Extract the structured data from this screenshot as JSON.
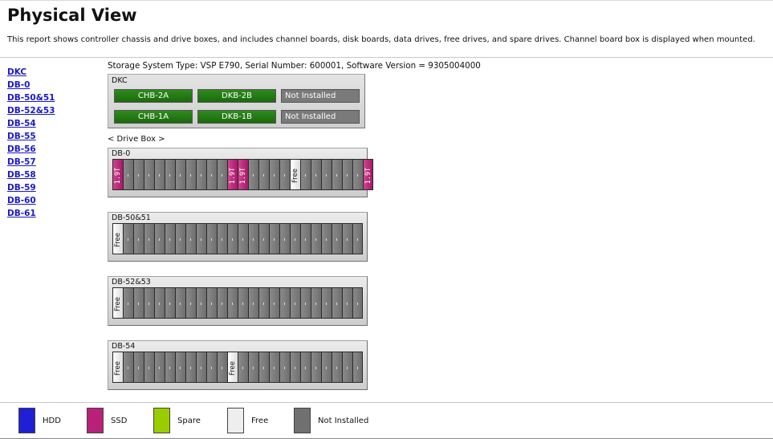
{
  "page": {
    "title": "Physical View",
    "description": "This report shows controller chassis and drive boxes, and includes channel boards, disk boards, data drives, free drives, and spare drives. Channel board box is displayed when mounted."
  },
  "nav": [
    {
      "label": "DKC"
    },
    {
      "label": "DB-0"
    },
    {
      "label": "DB-50&51"
    },
    {
      "label": "DB-52&53"
    },
    {
      "label": "DB-54"
    },
    {
      "label": "DB-55"
    },
    {
      "label": "DB-56"
    },
    {
      "label": "DB-57"
    },
    {
      "label": "DB-58"
    },
    {
      "label": "DB-59"
    },
    {
      "label": "DB-60"
    },
    {
      "label": "DB-61"
    }
  ],
  "storage_info": "Storage System Type: VSP E790, Serial Number: 600001, Software Version = 9305004000",
  "dkc": {
    "label": "DKC",
    "boards": [
      {
        "label": "CHB-2A",
        "state": "installed"
      },
      {
        "label": "DKB-2B",
        "state": "installed"
      },
      {
        "label": "Not Installed",
        "state": "not-installed"
      },
      {
        "label": "CHB-1A",
        "state": "installed"
      },
      {
        "label": "DKB-1B",
        "state": "installed"
      },
      {
        "label": "Not Installed",
        "state": "not-installed"
      }
    ]
  },
  "drive_box_label": "< Drive Box >",
  "drive_boxes": [
    {
      "label": "DB-0",
      "slots": [
        {
          "type": "ssd",
          "text": "1.9T"
        },
        {
          "type": "na"
        },
        {
          "type": "na"
        },
        {
          "type": "na"
        },
        {
          "type": "na"
        },
        {
          "type": "na"
        },
        {
          "type": "na"
        },
        {
          "type": "na"
        },
        {
          "type": "na"
        },
        {
          "type": "na"
        },
        {
          "type": "na"
        },
        {
          "type": "ssd",
          "text": "1.9T"
        },
        {
          "type": "ssd",
          "text": "1.9T"
        },
        {
          "type": "na"
        },
        {
          "type": "na"
        },
        {
          "type": "na"
        },
        {
          "type": "na"
        },
        {
          "type": "free",
          "text": "Free"
        },
        {
          "type": "na"
        },
        {
          "type": "na"
        },
        {
          "type": "na"
        },
        {
          "type": "na"
        },
        {
          "type": "na"
        },
        {
          "type": "na"
        },
        {
          "type": "ssd",
          "text": "1.9T"
        }
      ]
    },
    {
      "label": "DB-50&51",
      "slots": [
        {
          "type": "free",
          "text": "Free"
        },
        {
          "type": "na"
        },
        {
          "type": "na"
        },
        {
          "type": "na"
        },
        {
          "type": "na"
        },
        {
          "type": "na"
        },
        {
          "type": "na"
        },
        {
          "type": "na"
        },
        {
          "type": "na"
        },
        {
          "type": "na"
        },
        {
          "type": "na"
        },
        {
          "type": "na"
        },
        {
          "type": "na"
        },
        {
          "type": "na"
        },
        {
          "type": "na"
        },
        {
          "type": "na"
        },
        {
          "type": "na"
        },
        {
          "type": "na"
        },
        {
          "type": "na"
        },
        {
          "type": "na"
        },
        {
          "type": "na"
        },
        {
          "type": "na"
        },
        {
          "type": "na"
        },
        {
          "type": "na"
        }
      ]
    },
    {
      "label": "DB-52&53",
      "slots": [
        {
          "type": "free",
          "text": "Free"
        },
        {
          "type": "na"
        },
        {
          "type": "na"
        },
        {
          "type": "na"
        },
        {
          "type": "na"
        },
        {
          "type": "na"
        },
        {
          "type": "na"
        },
        {
          "type": "na"
        },
        {
          "type": "na"
        },
        {
          "type": "na"
        },
        {
          "type": "na"
        },
        {
          "type": "na"
        },
        {
          "type": "na"
        },
        {
          "type": "na"
        },
        {
          "type": "na"
        },
        {
          "type": "na"
        },
        {
          "type": "na"
        },
        {
          "type": "na"
        },
        {
          "type": "na"
        },
        {
          "type": "na"
        },
        {
          "type": "na"
        },
        {
          "type": "na"
        },
        {
          "type": "na"
        },
        {
          "type": "na"
        }
      ]
    },
    {
      "label": "DB-54",
      "slots": [
        {
          "type": "free",
          "text": "Free"
        },
        {
          "type": "na"
        },
        {
          "type": "na"
        },
        {
          "type": "na"
        },
        {
          "type": "na"
        },
        {
          "type": "na"
        },
        {
          "type": "na"
        },
        {
          "type": "na"
        },
        {
          "type": "na"
        },
        {
          "type": "na"
        },
        {
          "type": "na"
        },
        {
          "type": "free",
          "text": "Free"
        },
        {
          "type": "na"
        },
        {
          "type": "na"
        },
        {
          "type": "na"
        },
        {
          "type": "na"
        },
        {
          "type": "na"
        },
        {
          "type": "na"
        },
        {
          "type": "na"
        },
        {
          "type": "na"
        },
        {
          "type": "na"
        },
        {
          "type": "na"
        },
        {
          "type": "na"
        },
        {
          "type": "na"
        }
      ]
    }
  ],
  "legend": [
    {
      "label": "HDD",
      "color": "#1f1fd6"
    },
    {
      "label": "SSD",
      "color": "#b8207a"
    },
    {
      "label": "Spare",
      "color": "#9acd00"
    },
    {
      "label": "Free",
      "color": "#eeeeee"
    },
    {
      "label": "Not Installed",
      "color": "#707070"
    }
  ]
}
